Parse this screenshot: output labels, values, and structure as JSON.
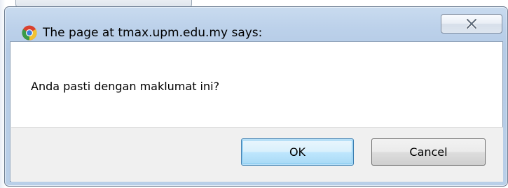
{
  "dialog": {
    "title": "The page at tmax.upm.edu.my says:",
    "title_icon": "chrome-icon",
    "close_icon": "close-icon",
    "message": "Anda pasti dengan maklumat ini?",
    "ok_label": "OK",
    "cancel_label": "Cancel"
  },
  "colors": {
    "frame": "#bcd1ea",
    "ok_button_border": "#3c7fb1",
    "footer": "#f0f0f0"
  }
}
